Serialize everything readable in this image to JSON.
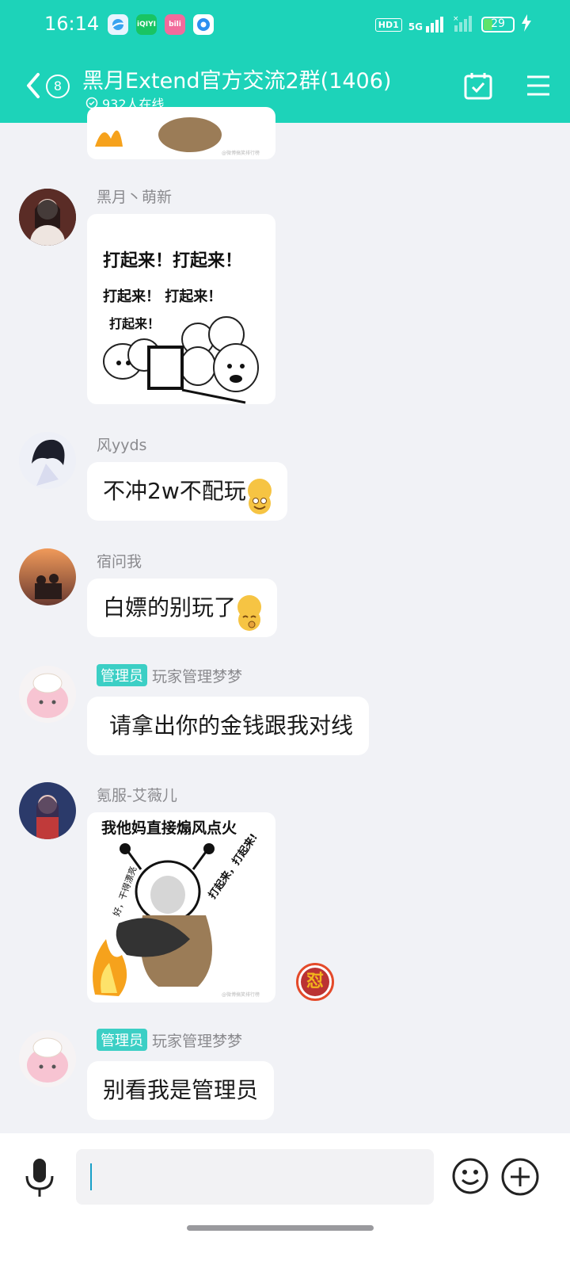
{
  "status_bar": {
    "time": "16:14",
    "app_icons": [
      "qq-browser-icon",
      "iqiyi-icon",
      "bilibili-icon",
      "app-icon"
    ],
    "hd": "HD1",
    "network": "5G",
    "battery": "29"
  },
  "header": {
    "badge_count": "8",
    "title": "黑月Extend官方交流2群(1406)",
    "online": "932人在线",
    "accent": "#1dd3b9"
  },
  "messages": [
    {
      "sender": "黑月丶萌新",
      "type": "sticker",
      "sticker_text": [
        "打起来！打起来！",
        "打起来！ 打起来！",
        "打起来！"
      ]
    },
    {
      "sender": "风yyds",
      "type": "text",
      "text": "不冲2w不配玩"
    },
    {
      "sender": "宿问我",
      "type": "text",
      "text": "白嫖的别玩了"
    },
    {
      "sender": "玩家管理梦梦",
      "role": "管理员",
      "type": "text",
      "text": "请拿出你的金钱跟我对线"
    },
    {
      "sender": "氪服-艾薇儿",
      "type": "sticker",
      "sticker_text": [
        "我他妈直接煽风点火",
        "好，干得漂亮",
        "打起来，打起来!"
      ]
    },
    {
      "sender": "玩家管理梦梦",
      "role": "管理员",
      "type": "text",
      "text": "别看我是管理员"
    }
  ],
  "reaction": "怼",
  "input": {
    "placeholder": ""
  }
}
